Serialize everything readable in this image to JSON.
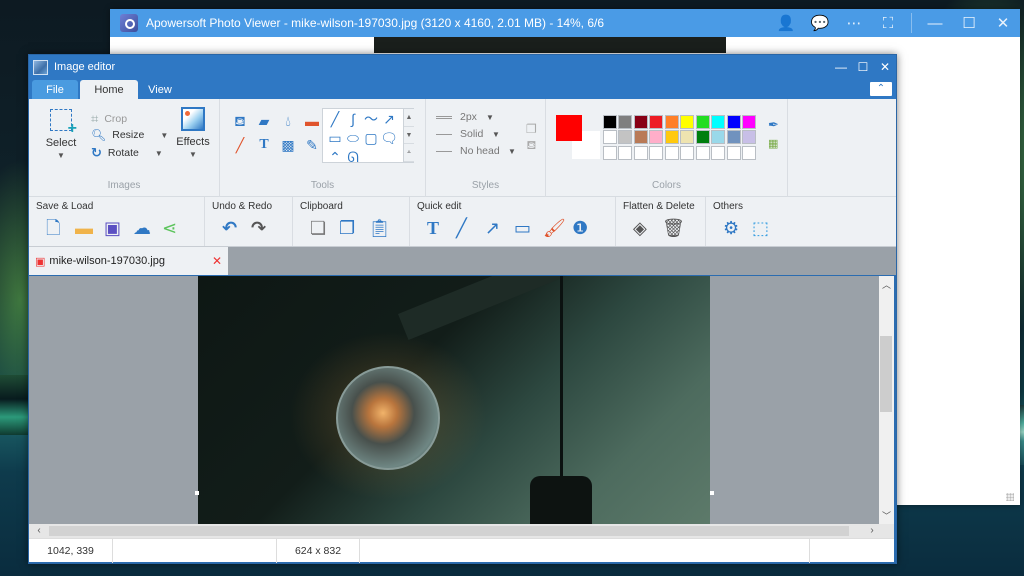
{
  "viewer": {
    "title": "Apowersoft Photo Viewer - mike-wilson-197030.jpg (3120 x 4160, 2.01 MB) - 14%, 6/6",
    "controls": {
      "account": "👤",
      "feedback": "💬",
      "more": "⋯",
      "fullscreen": "⛶",
      "minimize": "—",
      "maximize": "☐",
      "close": "✕"
    }
  },
  "editor": {
    "title": "Image editor",
    "window_buttons": {
      "minimize": "—",
      "maximize": "☐",
      "close": "✕"
    },
    "tabs": [
      {
        "label": "File"
      },
      {
        "label": "Home",
        "active": true
      },
      {
        "label": "View"
      }
    ],
    "collapse_ribbon": "⌃",
    "ribbon": {
      "images": {
        "label": "Images",
        "select": "Select",
        "crop": "Crop",
        "resize": "Resize",
        "rotate": "Rotate",
        "effects": "Effects"
      },
      "tools": {
        "label": "Tools",
        "items": [
          "fill-bucket",
          "eraser",
          "blur-drop",
          "highlighter",
          "brush",
          "text",
          "mosaic",
          "marker-pen"
        ],
        "shapes": [
          "line",
          "curve",
          "polyline",
          "arrow",
          "rectangle",
          "ellipse",
          "rounded-rectangle",
          "speech-bubble",
          "triangle",
          "callout"
        ]
      },
      "styles": {
        "label": "Styles",
        "thickness": "2px",
        "line_style": "Solid",
        "arrow_head": "No head"
      },
      "colors": {
        "label": "Colors",
        "primary": "#ff0000",
        "secondary": "#ffffff",
        "palette": [
          "#000000",
          "#7f7f7f",
          "#880015",
          "#ed1c24",
          "#ff7f27",
          "#ffff00",
          "#22dd22",
          "#00ffff",
          "#0000ff",
          "#ff00ff",
          "#ffffff",
          "#c3c3c3",
          "#b97a57",
          "#ffaec9",
          "#ffc90e",
          "#efe4b0",
          "#007f0e",
          "#99d9ea",
          "#7092be",
          "#c8bfe7",
          "#ffffff",
          "#ffffff",
          "#ffffff",
          "#ffffff",
          "#ffffff",
          "#ffffff",
          "#ffffff",
          "#ffffff",
          "#ffffff",
          "#ffffff"
        ]
      }
    },
    "toolbar": {
      "save_load": {
        "label": "Save & Load",
        "icons": [
          "new-file",
          "open-folder",
          "save",
          "upload-cloud",
          "share"
        ]
      },
      "undo_redo": {
        "label": "Undo & Redo",
        "icons": [
          "undo",
          "redo"
        ]
      },
      "clipboard": {
        "label": "Clipboard",
        "icons": [
          "cut",
          "copy",
          "paste"
        ]
      },
      "quick_edit": {
        "label": "Quick edit",
        "icons": [
          "text",
          "line",
          "arrow",
          "rectangle",
          "brush",
          "step-number"
        ]
      },
      "flatten_delete": {
        "label": "Flatten & Delete",
        "icons": [
          "flatten-layers",
          "delete"
        ]
      },
      "others": {
        "label": "Others",
        "icons": [
          "settings",
          "watermark"
        ]
      }
    },
    "document_tab": {
      "filename": "mike-wilson-197030.jpg",
      "close": "✕"
    },
    "status": {
      "cursor": "1042, 339",
      "size": "624 x 832"
    }
  }
}
